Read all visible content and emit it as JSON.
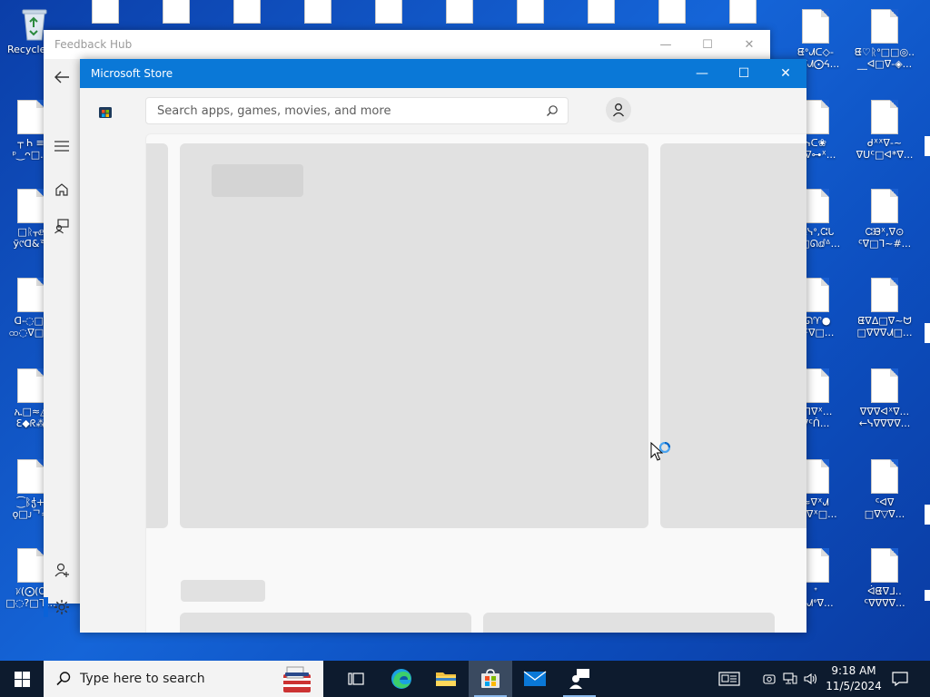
{
  "desktop": {
    "recycle_bin_label": "Recycle",
    "left_icons": [
      {
        "line1": "┬ Ꮒ ≡",
        "line2": "ᵖ‿ᴖ□..."
      },
      {
        "line1": "□ᚱᚁⅇ",
        "line2": "ỹ୯ᗡ&ᄒ"
      },
      {
        "line1": "ᗡ-◌□ᵒ",
        "line2": "ထ◌ᐁ□★"
      },
      {
        "line1": "ኢ□≈◬",
        "line2": "Ɛ◆ᖇ⁂"
      },
      {
        "line1": "⁐ᛔჭ+",
        "line2": "ǫ□ᴊᄀ≈"
      },
      {
        "line1": "ᜫ(⨀(ᘳ",
        "line2": "□◌?□ᒭ..."
      }
    ],
    "right_col1_icons": [
      {
        "line1": "ᘀᐤᗂᑕ◇-",
        "line2": "ᓄᐁᗂ⨀ᔦ..."
      },
      {
        "line1": "ᓭᑕ❀",
        "line2": "ᗐᐁ⊶ᕽ..."
      },
      {
        "line1": "⁂ᓭᐤ,ᘳᒐ",
        "line2": "□□ᘏⅆᐞ..."
      },
      {
        "line1": "ᐤᘏ♈●",
        "line2": "ᐁᑦᐁ□..."
      },
      {
        "line1": "ᓭᒣᐁᕽ...",
        "line2": "ᐁᑦᑏ..."
      },
      {
        "line1": "≈ᐁᕽᗂ",
        "line2": "ᑯᒣᐁᕽ□..."
      },
      {
        "line1": "ᐩ",
        "line2": "◌ᗂᐤᐁ..."
      }
    ],
    "right_col2_icons": [
      {
        "line1": "ᘀ♡ᚱᐤ□□◎..",
        "line2": "__ᐊ□ᐁ-◈..."
      },
      {
        "line1": "ᑯᕽᕽᐁ-~",
        "line2": "ᐁᑌᑦ□ᐊ*ᐁ..."
      },
      {
        "line1": "ᘳᙖᕽ,ᐁ⊙",
        "line2": "ᑦᐁ□ᒣ~#..."
      },
      {
        "line1": "ᘀᐁᐃ□ᐁ~ᗢ",
        "line2": "□ᐁᐁᐁᗂ□..."
      },
      {
        "line1": "ᐁᐁᐁᐊᕽᐁ...",
        "line2": "←ᓭᐁᐁᐁᐁ..."
      },
      {
        "line1": "ᑦᐊᐁ",
        "line2": "□ᐁ▽ᐁ..."
      },
      {
        "line1": "ᐋᘀᐁᒧ..",
        "line2": "ᑦᐁᐁᐁᐁ..."
      }
    ]
  },
  "feedback_hub": {
    "title": "Feedback Hub",
    "controls": {
      "minimize": "—",
      "maximize": "☐",
      "close": "✕"
    }
  },
  "store": {
    "title": "Microsoft Store",
    "controls": {
      "minimize": "—",
      "maximize": "☐",
      "close": "✕"
    },
    "search": {
      "placeholder": "Search apps, games, movies, and more"
    },
    "carousel": {
      "page_count": 6,
      "active_index": 0
    }
  },
  "taskbar": {
    "search_text": "Type here to search",
    "apps": [
      "task-view",
      "edge",
      "file-explorer",
      "microsoft-store",
      "mail",
      "feedback-hub"
    ],
    "active_app": "microsoft-store",
    "clock": {
      "time": "9:18 AM",
      "date": "11/5/2024"
    }
  },
  "colors": {
    "store_titlebar": "#0a78d7",
    "taskbar": "#0d1b2e",
    "desktop": "#1565d8"
  }
}
